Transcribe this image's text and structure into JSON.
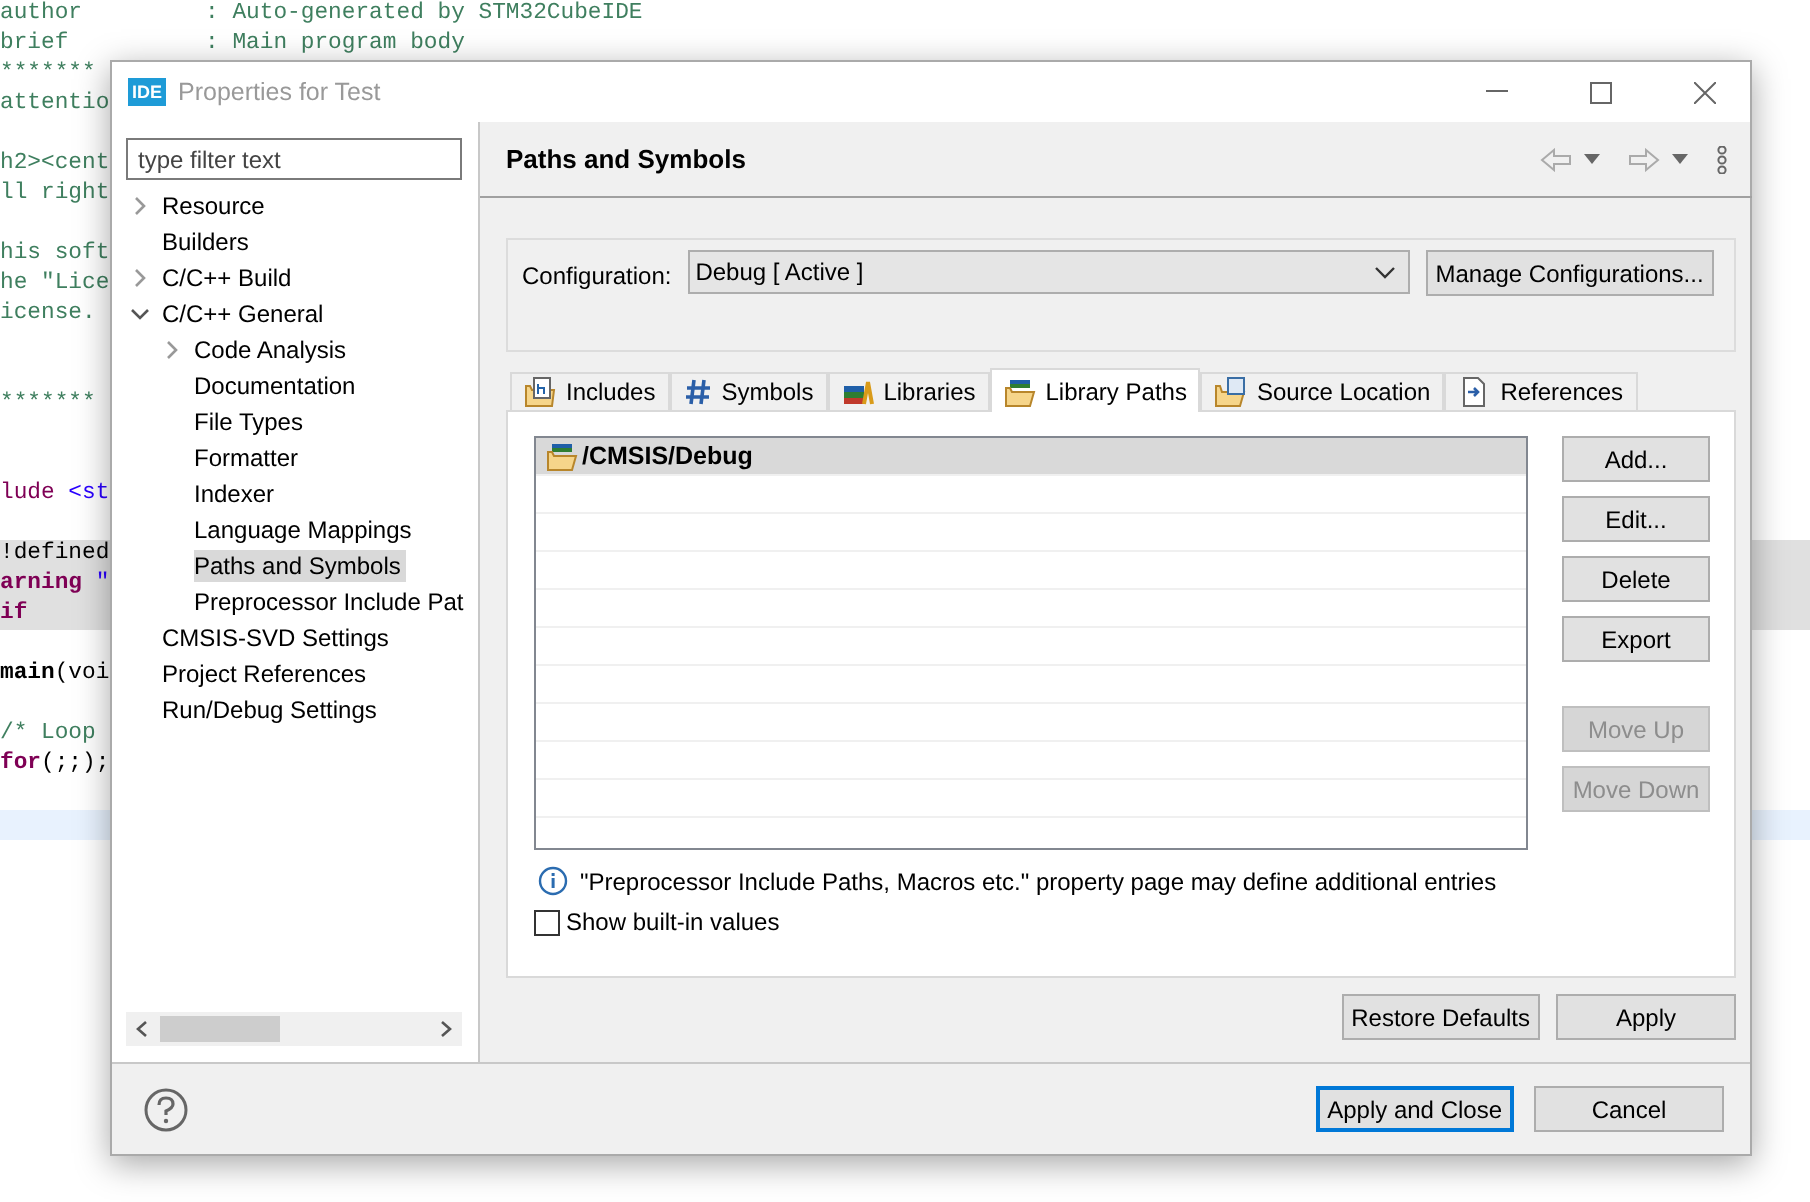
{
  "editor": {
    "lines": [
      {
        "kind": "code",
        "shaded": false,
        "current": false,
        "segments": [
          {
            "kind": "comment",
            "text": "author         : Auto-generated by STM32CubeIDE"
          }
        ]
      },
      {
        "kind": "code",
        "shaded": false,
        "current": false,
        "segments": [
          {
            "kind": "comment",
            "text": "brief          : Main program body"
          }
        ]
      },
      {
        "kind": "code",
        "shaded": false,
        "current": false,
        "segments": [
          {
            "kind": "comment",
            "text": "*******"
          }
        ]
      },
      {
        "kind": "code",
        "shaded": false,
        "current": false,
        "segments": [
          {
            "kind": "comment",
            "text": "attentio"
          }
        ]
      },
      {
        "kind": "blank",
        "shaded": false,
        "current": false
      },
      {
        "kind": "code",
        "shaded": false,
        "current": false,
        "segments": [
          {
            "kind": "comment",
            "text": "h2><cent"
          }
        ]
      },
      {
        "kind": "code",
        "shaded": false,
        "current": false,
        "segments": [
          {
            "kind": "comment",
            "text": "ll right"
          }
        ]
      },
      {
        "kind": "blank",
        "shaded": false,
        "current": false
      },
      {
        "kind": "code",
        "shaded": false,
        "current": false,
        "segments": [
          {
            "kind": "comment",
            "text": "his soft"
          }
        ]
      },
      {
        "kind": "code",
        "shaded": false,
        "current": false,
        "segments": [
          {
            "kind": "comment",
            "text": "he \"Lice"
          }
        ]
      },
      {
        "kind": "code",
        "shaded": false,
        "current": false,
        "segments": [
          {
            "kind": "comment",
            "text": "icense."
          }
        ]
      },
      {
        "kind": "blank",
        "shaded": false,
        "current": false
      },
      {
        "kind": "blank",
        "shaded": false,
        "current": false
      },
      {
        "kind": "code",
        "shaded": false,
        "current": false,
        "segments": [
          {
            "kind": "comment",
            "text": "*******"
          }
        ]
      },
      {
        "kind": "blank",
        "shaded": false,
        "current": false
      },
      {
        "kind": "blank",
        "shaded": false,
        "current": false
      },
      {
        "kind": "code",
        "shaded": false,
        "current": false,
        "segments": [
          {
            "kind": "keyword",
            "text": "lude"
          },
          {
            "kind": "string",
            "text": " <st"
          }
        ]
      },
      {
        "kind": "blank",
        "shaded": false,
        "current": false
      },
      {
        "kind": "code",
        "shaded": true,
        "current": false,
        "segments": [
          {
            "kind": "plain",
            "text": "!defined"
          }
        ]
      },
      {
        "kind": "code",
        "shaded": true,
        "current": false,
        "segments": [
          {
            "kind": "keyword",
            "text": "arning"
          },
          {
            "kind": "string",
            "text": " \""
          }
        ]
      },
      {
        "kind": "code",
        "shaded": true,
        "current": false,
        "segments": [
          {
            "kind": "keyword",
            "text": "if"
          }
        ]
      },
      {
        "kind": "blank",
        "shaded": false,
        "current": false
      },
      {
        "kind": "code",
        "shaded": false,
        "current": false,
        "segments": [
          {
            "kind": "function",
            "text": "main"
          },
          {
            "kind": "plain",
            "text": "(voi"
          }
        ]
      },
      {
        "kind": "blank",
        "shaded": false,
        "current": false
      },
      {
        "kind": "code",
        "shaded": false,
        "current": false,
        "segments": [
          {
            "kind": "comment",
            "text": "/* Loop"
          }
        ]
      },
      {
        "kind": "code",
        "shaded": false,
        "current": false,
        "segments": [
          {
            "kind": "keyword",
            "text": "for"
          },
          {
            "kind": "plain",
            "text": "(;;);"
          }
        ]
      },
      {
        "kind": "blank",
        "shaded": false,
        "current": false
      },
      {
        "kind": "blank",
        "shaded": false,
        "current": true
      }
    ]
  },
  "dialog": {
    "title": "Properties for Test",
    "app_badge": "IDE",
    "filter": {
      "placeholder": "type filter text"
    },
    "tree": [
      {
        "label": "Resource",
        "selected": false,
        "expanded": false
      },
      {
        "label": "Builders",
        "selected": false
      },
      {
        "label": "C/C++ Build",
        "selected": false,
        "expanded": false
      },
      {
        "label": "C/C++ General",
        "selected": false,
        "expanded": true,
        "children": [
          {
            "label": "Code Analysis",
            "selected": false,
            "expanded": false
          },
          {
            "label": "Documentation",
            "selected": false
          },
          {
            "label": "File Types",
            "selected": false
          },
          {
            "label": "Formatter",
            "selected": false
          },
          {
            "label": "Indexer",
            "selected": false
          },
          {
            "label": "Language Mappings",
            "selected": false
          },
          {
            "label": "Paths and Symbols",
            "selected": true
          },
          {
            "label": "Preprocessor Include Pat",
            "selected": false
          }
        ]
      },
      {
        "label": "CMSIS-SVD Settings",
        "selected": false
      },
      {
        "label": "Project References",
        "selected": false
      },
      {
        "label": "Run/Debug Settings",
        "selected": false
      }
    ],
    "page": {
      "title": "Paths and Symbols",
      "configuration": {
        "label": "Configuration:",
        "value": "Debug  [ Active ]",
        "button": "Manage Configurations..."
      },
      "tabs": [
        {
          "label": "Includes",
          "selected": false
        },
        {
          "label": "Symbols",
          "selected": false
        },
        {
          "label": "Libraries",
          "selected": false
        },
        {
          "label": "Library Paths",
          "selected": true
        },
        {
          "label": "Source Location",
          "selected": false
        },
        {
          "label": "References",
          "selected": false
        }
      ],
      "entries": [
        {
          "label": "/CMSIS/Debug",
          "selected": true
        }
      ],
      "side_buttons": [
        {
          "label": "Add...",
          "disabled": false
        },
        {
          "label": "Edit...",
          "disabled": false
        },
        {
          "label": "Delete",
          "disabled": false
        },
        {
          "label": "Export",
          "disabled": false
        },
        {
          "label": "Move Up",
          "disabled": true
        },
        {
          "label": "Move Down",
          "disabled": true
        }
      ],
      "info": "\"Preprocessor Include Paths, Macros etc.\" property page may define additional entries",
      "show_builtin": {
        "label": "Show built-in values",
        "checked": false
      },
      "buttons": [
        "Restore Defaults",
        "Apply"
      ]
    },
    "footer_buttons": [
      {
        "label": "Apply and Close",
        "default": true
      },
      {
        "label": "Cancel",
        "default": false
      }
    ]
  }
}
